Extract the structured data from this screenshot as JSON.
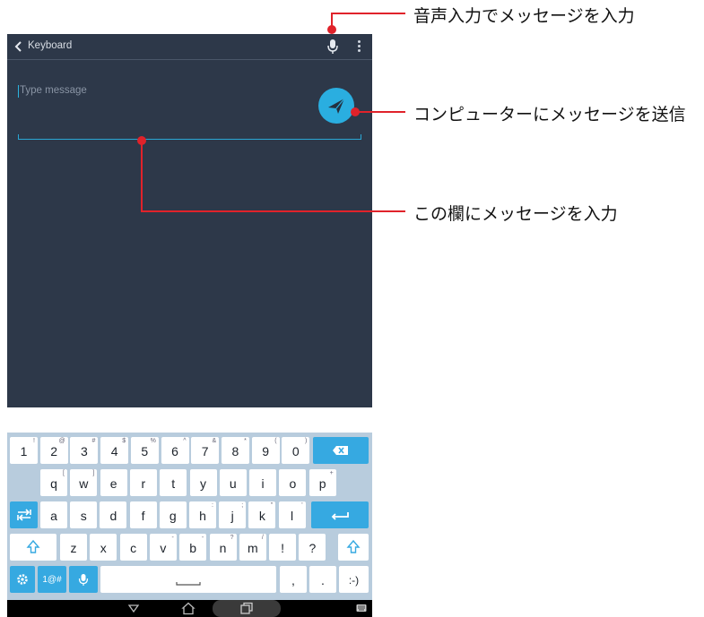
{
  "app": {
    "title": "Keyboard",
    "message_placeholder": "Type message"
  },
  "callouts": {
    "voice": "音声入力でメッセージを入力",
    "send": "コンピューターにメッセージを送信",
    "field": "この欄にメッセージを入力"
  },
  "keyboard": {
    "row1": [
      {
        "k": "1",
        "s": "!"
      },
      {
        "k": "2",
        "s": "@"
      },
      {
        "k": "3",
        "s": "#"
      },
      {
        "k": "4",
        "s": "$"
      },
      {
        "k": "5",
        "s": "%"
      },
      {
        "k": "6",
        "s": "^"
      },
      {
        "k": "7",
        "s": "&"
      },
      {
        "k": "8",
        "s": "*"
      },
      {
        "k": "9",
        "s": "("
      },
      {
        "k": "0",
        "s": ")"
      }
    ],
    "row2": [
      {
        "k": "q",
        "s": "["
      },
      {
        "k": "w",
        "s": "]"
      },
      {
        "k": "e",
        "s": ""
      },
      {
        "k": "r",
        "s": ""
      },
      {
        "k": "t",
        "s": ""
      },
      {
        "k": "y",
        "s": ""
      },
      {
        "k": "u",
        "s": ""
      },
      {
        "k": "i",
        "s": ""
      },
      {
        "k": "o",
        "s": ""
      },
      {
        "k": "p",
        "s": "+"
      }
    ],
    "row3": [
      {
        "k": "a",
        "s": ""
      },
      {
        "k": "s",
        "s": ""
      },
      {
        "k": "d",
        "s": ""
      },
      {
        "k": "f",
        "s": ""
      },
      {
        "k": "g",
        "s": ""
      },
      {
        "k": "h",
        "s": ":"
      },
      {
        "k": "j",
        "s": ";"
      },
      {
        "k": "k",
        "s": "\""
      },
      {
        "k": "l",
        "s": "'"
      }
    ],
    "row4": [
      {
        "k": "z",
        "s": ""
      },
      {
        "k": "x",
        "s": ""
      },
      {
        "k": "c",
        "s": ""
      },
      {
        "k": "v",
        "s": "-"
      },
      {
        "k": "b",
        "s": "-"
      },
      {
        "k": "n",
        "s": "?"
      },
      {
        "k": "m",
        "s": "/"
      },
      {
        "k": "!",
        "s": ""
      },
      {
        "k": "?",
        "s": ""
      }
    ],
    "symbols_label": "1@#",
    "comma": ",",
    "period": ".",
    "smiley": ":-)"
  },
  "colors": {
    "app_bg": "#2d3849",
    "accent": "#2aaee0",
    "callout": "#e0222a",
    "keyboard_bg": "#b8ccdd"
  }
}
